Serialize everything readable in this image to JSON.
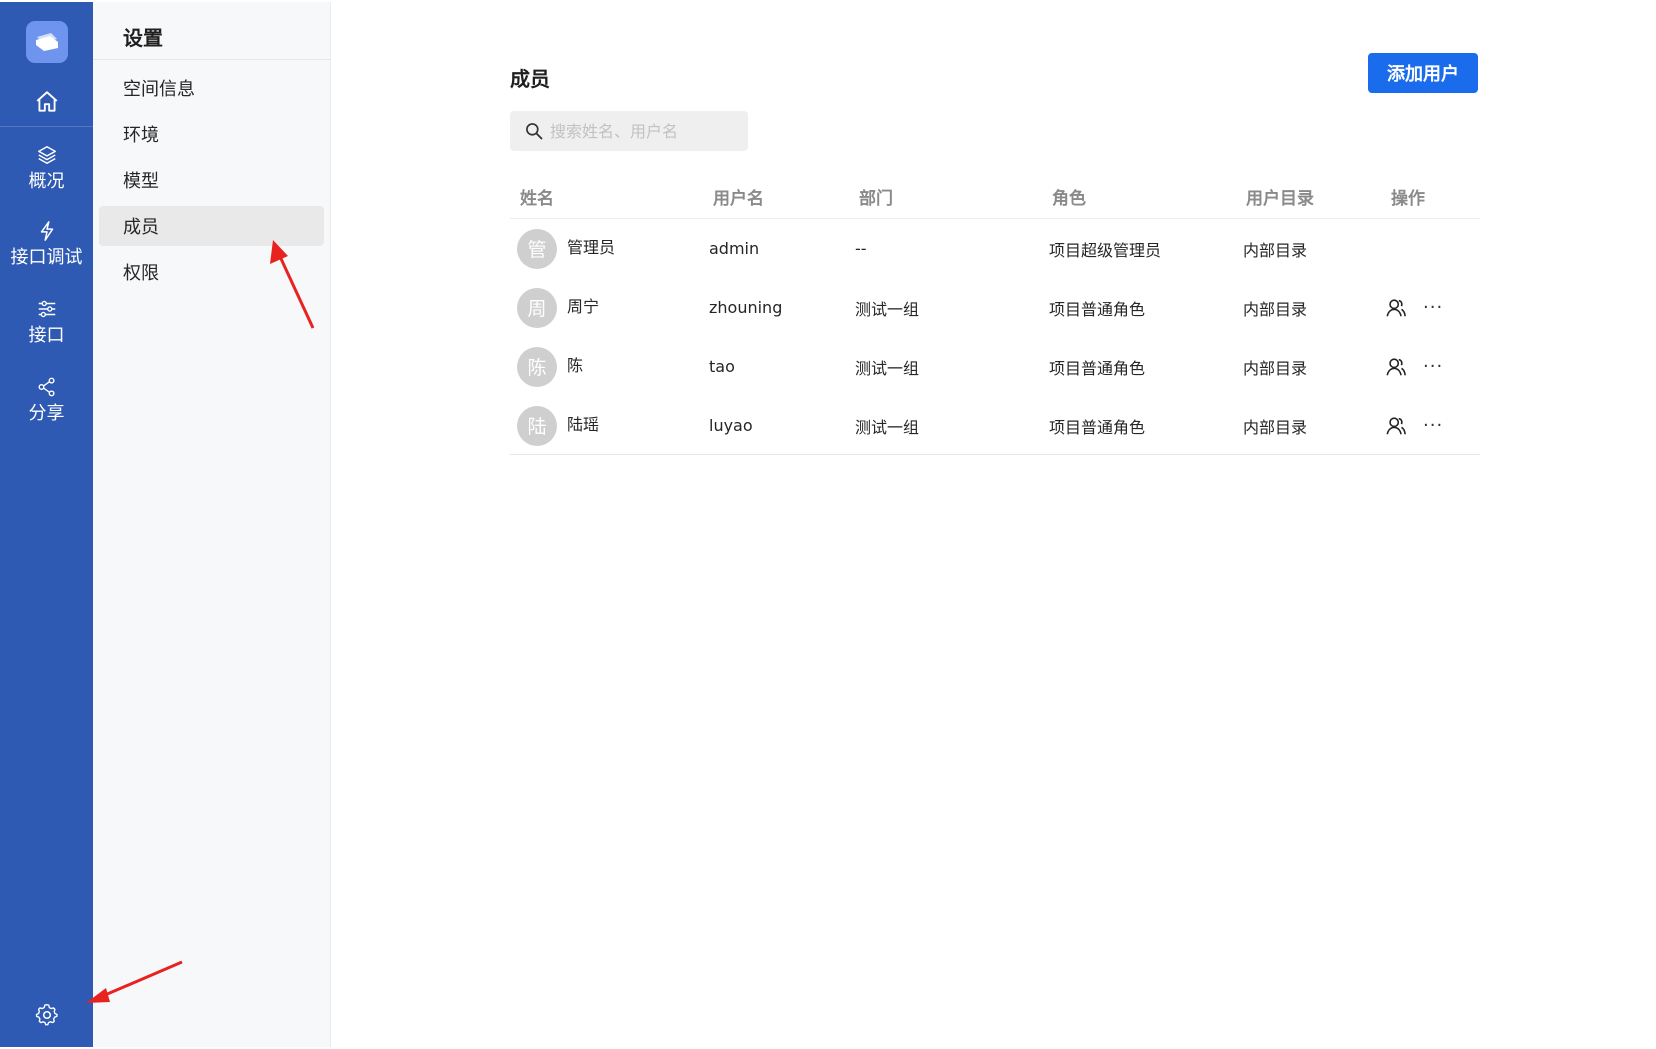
{
  "rail": {
    "items": [
      {
        "label": "概况",
        "icon": "layers-icon"
      },
      {
        "label": "接口调试",
        "icon": "lightning-icon"
      },
      {
        "label": "接口",
        "icon": "sliders-icon"
      },
      {
        "label": "分享",
        "icon": "share-icon"
      }
    ]
  },
  "settings": {
    "title": "设置",
    "items": [
      {
        "label": "空间信息"
      },
      {
        "label": "环境"
      },
      {
        "label": "模型"
      },
      {
        "label": "成员"
      },
      {
        "label": "权限"
      }
    ],
    "active": "成员"
  },
  "main": {
    "title": "成员",
    "add_button": "添加用户",
    "search_placeholder": "搜索姓名、用户名",
    "columns": [
      "姓名",
      "用户名",
      "部门",
      "角色",
      "用户目录",
      "操作"
    ],
    "rows": [
      {
        "avatar": "管",
        "name": "管理员",
        "username": "admin",
        "dept": "--",
        "role": "项目超级管理员",
        "directory": "内部目录",
        "actions": false
      },
      {
        "avatar": "周",
        "name": "周宁",
        "username": "zhouning",
        "dept": "测试一组",
        "role": "项目普通角色",
        "directory": "内部目录",
        "actions": true
      },
      {
        "avatar": "陈",
        "name": "陈",
        "username": "tao",
        "dept": "测试一组",
        "role": "项目普通角色",
        "directory": "内部目录",
        "actions": true
      },
      {
        "avatar": "陆",
        "name": "陆瑶",
        "username": "luyao",
        "dept": "测试一组",
        "role": "项目普通角色",
        "directory": "内部目录",
        "actions": true
      }
    ],
    "more_glyph": "···"
  },
  "colors": {
    "rail_bg": "#2f5ab4",
    "primary": "#1a6cec",
    "annotation_arrow": "#e8231f"
  }
}
